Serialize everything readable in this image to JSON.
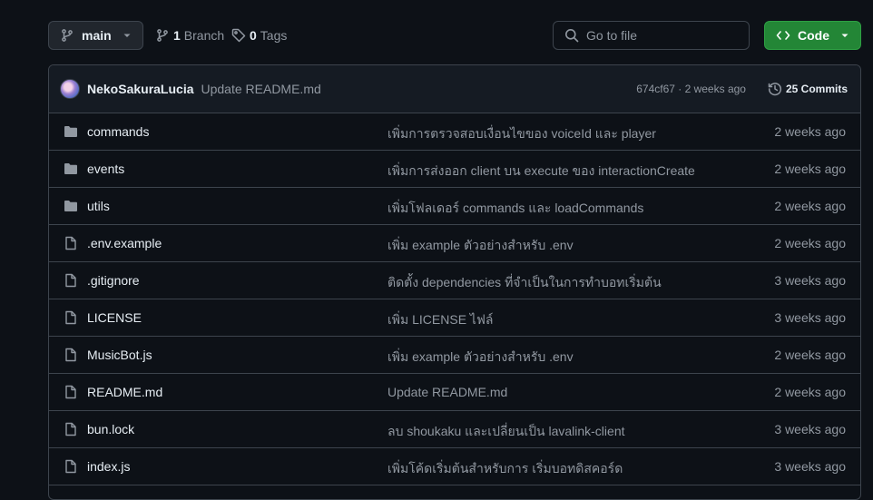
{
  "branch": {
    "name": "main"
  },
  "branches": {
    "count": "1",
    "label": "Branch"
  },
  "tags": {
    "count": "0",
    "label": "Tags"
  },
  "search": {
    "placeholder": "Go to file"
  },
  "code_button": {
    "label": "Code"
  },
  "commit": {
    "author": "NekoSakuraLucia",
    "message": "Update README.md",
    "hash_and_time": "674cf67 · 2 weeks ago",
    "commits_count": "25 Commits"
  },
  "files": [
    {
      "type": "folder",
      "name": "commands",
      "message": "เพิ่มการตรวจสอบเงื่อนไขของ voiceId และ player",
      "age": "2 weeks ago"
    },
    {
      "type": "folder",
      "name": "events",
      "message": "เพิ่มการส่งออก client บน execute ของ interactionCreate",
      "age": "2 weeks ago"
    },
    {
      "type": "folder",
      "name": "utils",
      "message": "เพิ่มโฟลเดอร์ commands และ loadCommands",
      "age": "2 weeks ago"
    },
    {
      "type": "file",
      "name": ".env.example",
      "message": "เพิ่ม example ตัวอย่างสำหรับ .env",
      "age": "2 weeks ago"
    },
    {
      "type": "file",
      "name": ".gitignore",
      "message": "ติดตั้ง dependencies ที่จำเป็นในการทำบอทเริ่มต้น",
      "age": "3 weeks ago"
    },
    {
      "type": "file",
      "name": "LICENSE",
      "message": "เพิ่ม LICENSE ไฟล์",
      "age": "3 weeks ago"
    },
    {
      "type": "file",
      "name": "MusicBot.js",
      "message": "เพิ่ม example ตัวอย่างสำหรับ .env",
      "age": "2 weeks ago"
    },
    {
      "type": "file",
      "name": "README.md",
      "message": "Update README.md",
      "age": "2 weeks ago"
    },
    {
      "type": "file",
      "name": "bun.lock",
      "message": "ลบ shoukaku และเปลี่ยนเป็น lavalink-client",
      "age": "3 weeks ago"
    },
    {
      "type": "file",
      "name": "index.js",
      "message": "เพิ่มโค้ดเริ่มต้นสำหรับการ เริ่มบอทดิสคอร์ด",
      "age": "3 weeks ago"
    }
  ],
  "colors": {
    "accent_green": "#238636",
    "background": "#0d1117",
    "border": "#3d444d",
    "muted_text": "#9198a1",
    "folder_icon": "#9198a1"
  },
  "icons": {
    "branch": "git-branch-icon",
    "tag": "tag-icon",
    "search": "search-icon",
    "code": "code-icon",
    "history": "history-icon",
    "folder": "folder-icon",
    "file": "file-icon"
  }
}
